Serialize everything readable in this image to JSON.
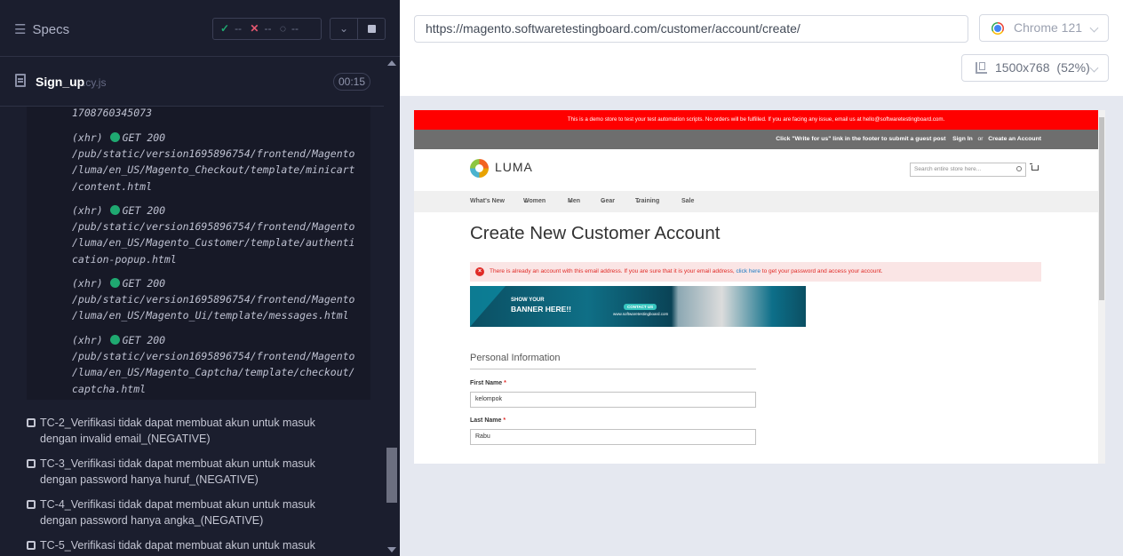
{
  "runner": {
    "specs_label": "Specs",
    "stats": {
      "passed": "--",
      "failed": "--",
      "pending": "--"
    },
    "spec": {
      "name": "Sign_up",
      "ext": ".cy.js",
      "duration": "00:15"
    },
    "log_top": "1708760345073",
    "log_entries": [
      {
        "prefix": "(xhr)",
        "method": "GET 200",
        "lines": [
          "/pub/static/version1695896754/frontend/Magento",
          "/luma/en_US/Magento_Checkout/template/minicart",
          "/content.html"
        ]
      },
      {
        "prefix": "(xhr)",
        "method": "GET 200",
        "lines": [
          "/pub/static/version1695896754/frontend/Magento",
          "/luma/en_US/Magento_Customer/template/authenti",
          "cation-popup.html"
        ]
      },
      {
        "prefix": "(xhr)",
        "method": "GET 200",
        "lines": [
          "/pub/static/version1695896754/frontend/Magento",
          "/luma/en_US/Magento_Ui/template/messages.html"
        ]
      },
      {
        "prefix": "(xhr)",
        "method": "GET 200",
        "lines": [
          "/pub/static/version1695896754/frontend/Magento",
          "/luma/en_US/Magento_Captcha/template/checkout/",
          "captcha.html"
        ]
      }
    ],
    "tests": [
      {
        "line1": "TC-2_Verifikasi tidak dapat membuat akun untuk masuk",
        "line2": "dengan invalid email_(NEGATIVE)"
      },
      {
        "line1": "TC-3_Verifikasi tidak dapat membuat akun untuk masuk",
        "line2": "dengan password hanya huruf_(NEGATIVE)"
      },
      {
        "line1": "TC-4_Verifikasi tidak dapat membuat akun untuk masuk",
        "line2": "dengan password hanya angka_(NEGATIVE)"
      },
      {
        "line1": "TC-5_Verifikasi tidak dapat membuat akun untuk masuk",
        "line2": ""
      }
    ]
  },
  "browser_bar": {
    "url": "https://magento.softwaretestingboard.com/customer/account/create/",
    "browser": "Chrome 121",
    "viewport": "1500x768",
    "zoom": "(52%)"
  },
  "site": {
    "demo_notice": "This is a demo store to test your test automation scripts. No orders will be fulfilled. If you are facing any issue, email us at hello@softwaretestingboard.com.",
    "panel_text": "Click \"Write for us\" link in the footer to submit a guest post",
    "sign_in": "Sign In",
    "or": "or",
    "create_account": "Create an Account",
    "logo": "LUMA",
    "search_placeholder": "Search entire store here...",
    "nav": [
      "What's New",
      "Women",
      "Men",
      "Gear",
      "Training",
      "Sale"
    ],
    "page_title": "Create New Customer Account",
    "error_message": "There is already an account with this email address. If you are sure that it is your email address,",
    "error_link": "click here",
    "error_suffix": "to get your password and access your account.",
    "banner_line1": "SHOW YOUR",
    "banner_line2": "BANNER HERE!!",
    "banner_button": "CONTACT US",
    "banner_site": "www.softwaretestingboard.com",
    "section_title": "Personal Information",
    "first_name_label": "First Name",
    "first_name_value": "kelompok",
    "last_name_label": "Last Name",
    "last_name_value": "Rabu",
    "required_mark": "*"
  }
}
